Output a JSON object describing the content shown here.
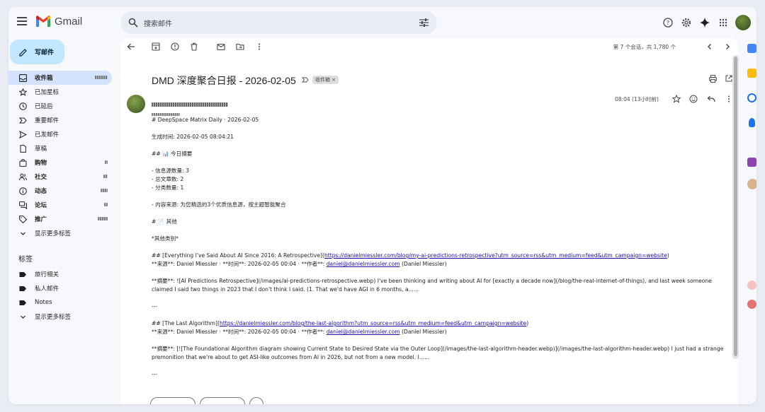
{
  "app": {
    "name": "Gmail"
  },
  "search": {
    "placeholder": "搜索邮件"
  },
  "compose": {
    "label": "写邮件"
  },
  "sidebar": {
    "items": [
      {
        "label": "收件箱",
        "active": true,
        "bold": true,
        "icon": "inbox-icon"
      },
      {
        "label": "已加星标",
        "icon": "star-icon"
      },
      {
        "label": "已延后",
        "icon": "clock-icon"
      },
      {
        "label": "重要邮件",
        "icon": "important-icon"
      },
      {
        "label": "已发邮件",
        "icon": "send-icon"
      },
      {
        "label": "草稿",
        "icon": "draft-icon"
      },
      {
        "label": "购物",
        "bold": true,
        "icon": "shopping-icon"
      },
      {
        "label": "社交",
        "bold": true,
        "icon": "social-icon"
      },
      {
        "label": "动态",
        "bold": true,
        "icon": "updates-icon"
      },
      {
        "label": "论坛",
        "bold": true,
        "icon": "forum-icon"
      },
      {
        "label": "推广",
        "bold": true,
        "icon": "tag-icon"
      },
      {
        "label": "显示更多标签",
        "icon": "chevron-down-icon"
      }
    ],
    "labels_heading": "标签",
    "labels": [
      {
        "label": "旅行相关",
        "icon": "label-icon"
      },
      {
        "label": "私人邮件",
        "icon": "label-icon"
      },
      {
        "label": "Notes",
        "icon": "label-icon"
      },
      {
        "label": "显示更多标签",
        "icon": "chevron-down-icon"
      }
    ]
  },
  "pager": {
    "text": "第 7 个会话，共 1,780 个"
  },
  "message": {
    "subject": "DMD 深度聚合日报 - 2026-02-05",
    "badge": "收件箱 ×",
    "time": "08:04 (13小时前)",
    "lines": {
      "h1": "# DeepSpace Matrix Daily · 2026-02-05",
      "generated": "生成时间: 2026-02-05 08:04:21",
      "summary_head": "## 📊 今日摘要",
      "s1": "- 信息源数量: 3",
      "s2": "- 总文章数: 2",
      "s3": "- 分类数量: 1",
      "s4": "- 内容来源: 为您精选的3个优质信息源，按主题智能聚合",
      "other_head": "# 📄 其他",
      "other_cat": "*其他类别*",
      "a1_title_pre": "## [Everything I've Said About AI Since 2016: A Retrospective](",
      "a1_url": "https://danielmiessler.com/blog/my-ai-predictions-retrospective?utm_source=rss&utm_medium=feed&utm_campaign=website",
      "a1_title_post": ")",
      "a1_meta_pre": "**来源**: Daniel Miessler · **时间**: 2026-02-05 00:04 · **作者**: ",
      "a1_email": "daniel@danielmiessler.com",
      "a1_meta_post": " (Daniel Miessler)",
      "a1_summary": "**摘要**: ![AI Predictions Retrospective](/images/ai-predictions-retrospective.webp) I've been thinking and writing about AI for [exactly a decade now](/blog/the-real-internet-of-things), and last week someone claimed I said two things in 2023 that I don't think I said. (1. That we'd have AGI in 6 months, a......",
      "sep1": "---",
      "a2_title_pre": "## [The Last Algorithm](",
      "a2_url": "https://danielmiessler.com/blog/the-last-algorithm?utm_source=rss&utm_medium=feed&utm_campaign=website",
      "a2_title_post": ")",
      "a2_meta_pre": "**来源**: Daniel Miessler · **时间**: 2026-02-05 00:04 · **作者**: ",
      "a2_email": "daniel@danielmiessler.com",
      "a2_meta_post": " (Daniel Miessler)",
      "a2_summary": "**摘要**: [![The Foundational Algorithm diagram showing Current State to Desired State via the Outer Loop](/images/the-last-algorithm-header.webp)](/images/the-last-algorithm-header.webp) I just had a strange premonition that we're about to get ASI-like outcomes from AI in 2026, but not from a new model. I......",
      "sep2": "---"
    }
  },
  "colors": {
    "accent": "#c2e7ff",
    "active_nav": "#d3e3fd",
    "link": "#1a0dab",
    "page_bg": "#f6f8fc"
  }
}
